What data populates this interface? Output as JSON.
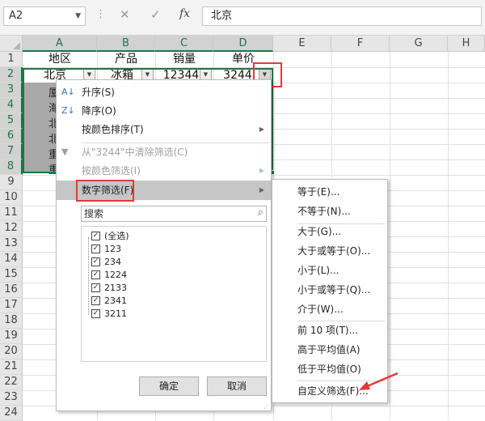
{
  "formula_bar": {
    "name_box": "A2",
    "cancel_icon": "close-icon",
    "enter_icon": "check-icon",
    "fx_label": "fx",
    "content": "北京"
  },
  "columns": [
    "A",
    "B",
    "C",
    "D",
    "E",
    "F",
    "G",
    "H"
  ],
  "rows": [
    "1",
    "2",
    "3",
    "4",
    "5",
    "6",
    "7",
    "8",
    "9",
    "10",
    "11",
    "12",
    "13",
    "14",
    "15",
    "16",
    "17",
    "18",
    "19",
    "20",
    "21",
    "22",
    "23",
    "24"
  ],
  "cells": {
    "header": [
      "地区",
      "产品",
      "销量",
      "单价"
    ],
    "row2": [
      "北京",
      "冰箱",
      "12344",
      "3244"
    ],
    "partial_rows": [
      "厦",
      "海",
      "北",
      "北",
      "重",
      "重"
    ]
  },
  "menu": {
    "items": [
      {
        "label": "升序(S)",
        "icon": "sort-ascending-icon"
      },
      {
        "label": "降序(O)",
        "icon": "sort-descending-icon"
      },
      {
        "label": "按颜色排序(T)",
        "submenu": true
      },
      {
        "label": "从\"3244\"中清除筛选(C)",
        "icon": "clear-filter-icon",
        "disabled": true
      },
      {
        "label": "按颜色筛选(I)",
        "submenu": true,
        "disabled": true
      },
      {
        "label": "数字筛选(F)",
        "submenu": true,
        "highlighted": true
      }
    ],
    "search_placeholder": "搜索",
    "list": [
      {
        "label": "(全选)",
        "checked": true
      },
      {
        "label": "123",
        "checked": true
      },
      {
        "label": "234",
        "checked": true
      },
      {
        "label": "1224",
        "checked": true
      },
      {
        "label": "2133",
        "checked": true
      },
      {
        "label": "2341",
        "checked": true
      },
      {
        "label": "3211",
        "checked": true
      }
    ],
    "ok_label": "确定",
    "cancel_label": "取消"
  },
  "submenu": {
    "items": [
      "等于(E)...",
      "不等于(N)...",
      "大于(G)...",
      "大于或等于(O)...",
      "小于(L)...",
      "小于或等于(Q)...",
      "介于(W)...",
      "前 10 项(T)...",
      "高于平均值(A)",
      "低于平均值(O)",
      "自定义筛选(F)..."
    ]
  },
  "colors": {
    "selection": "#217346",
    "annotation": "#e23a3a",
    "highlight": "#c6c6c6"
  }
}
